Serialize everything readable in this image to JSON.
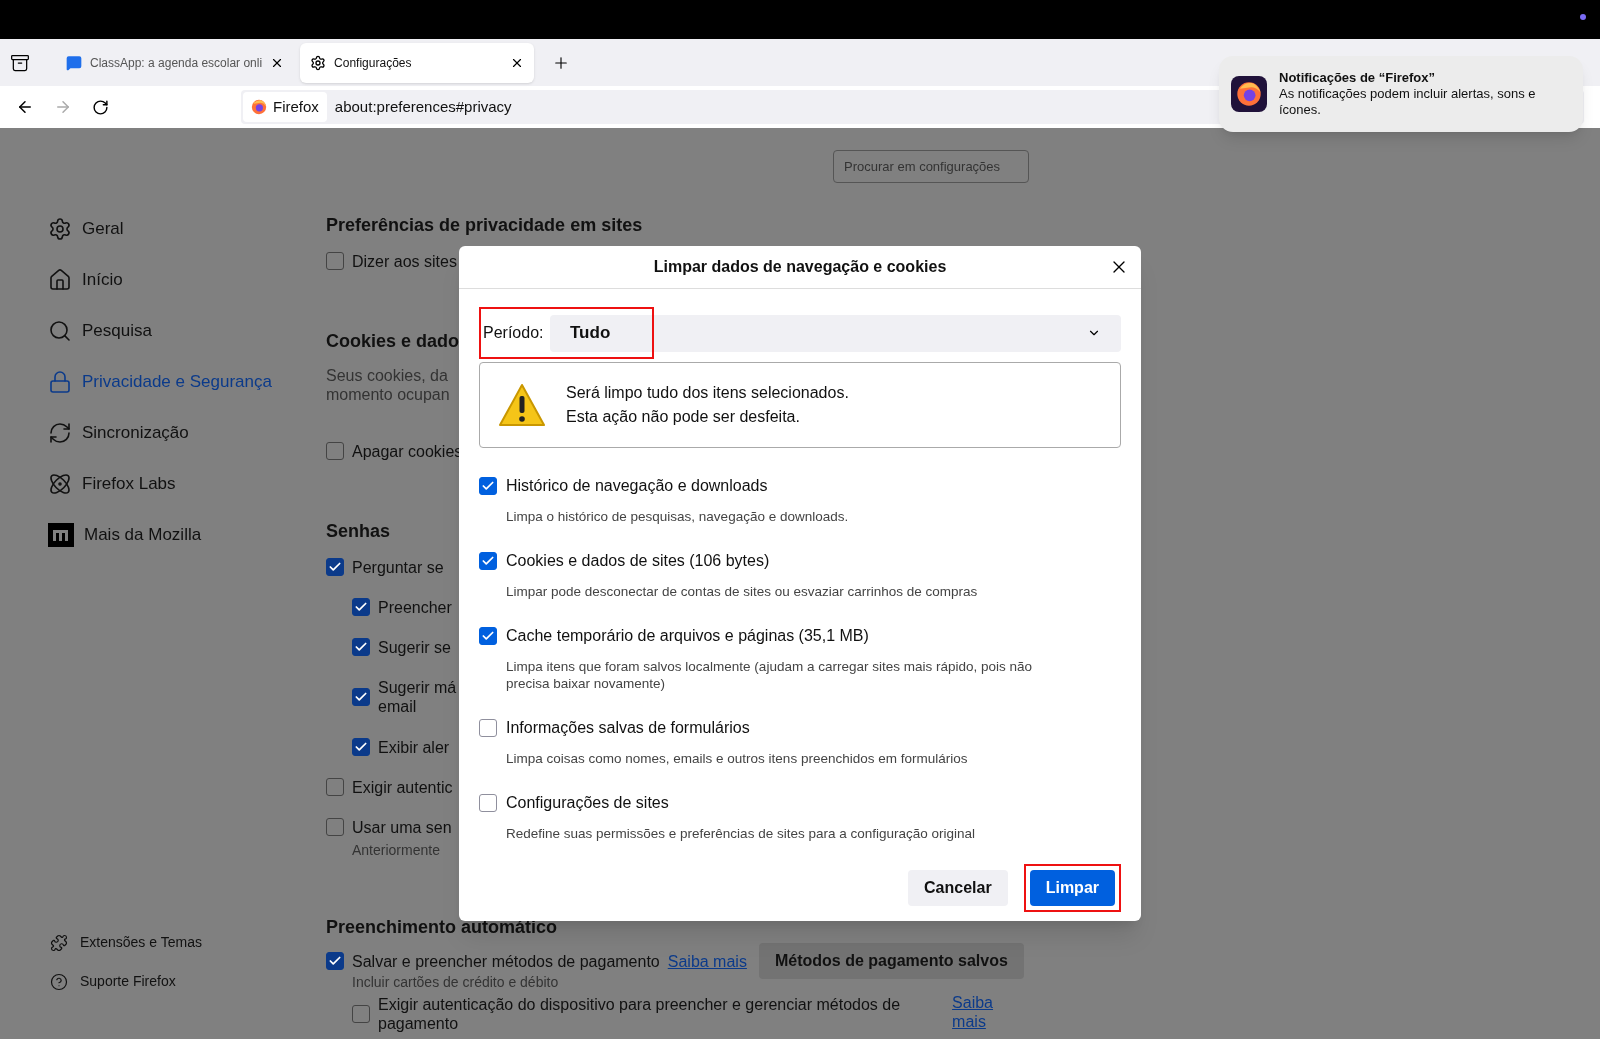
{
  "browser": {
    "tabs": [
      {
        "title": "ClassApp: a agenda escolar onli",
        "selected": false
      },
      {
        "title": "Configurações",
        "selected": true
      }
    ],
    "identity_label": "Firefox",
    "url": "about:preferences#privacy"
  },
  "notification": {
    "title": "Notificações de “Firefox”",
    "body": "As notificações podem incluir alertas, sons e ícones."
  },
  "search": {
    "placeholder": "Procurar em configurações"
  },
  "sidebar": {
    "items": [
      {
        "label": "Geral",
        "selected": false
      },
      {
        "label": "Início",
        "selected": false
      },
      {
        "label": "Pesquisa",
        "selected": false
      },
      {
        "label": "Privacidade e Segurança",
        "selected": true
      },
      {
        "label": "Sincronização",
        "selected": false
      },
      {
        "label": "Firefox Labs",
        "selected": false
      },
      {
        "label": "Mais da Mozilla",
        "selected": false
      }
    ],
    "footer": [
      {
        "label": "Extensões e Temas"
      },
      {
        "label": "Suporte Firefox"
      }
    ]
  },
  "content": [
    {
      "kind": "heading",
      "text": "Preferências de privacidade em sites"
    },
    {
      "kind": "checkbox",
      "lines": [
        "Dizer aos sites"
      ],
      "checked": false
    },
    {
      "kind": "heading",
      "text": "Cookies e dado"
    },
    {
      "kind": "text",
      "lines": [
        "Seus cookies, da",
        "momento ocupan"
      ]
    },
    {
      "kind": "checkbox",
      "lines": [
        "Apagar cookies"
      ],
      "checked": false
    },
    {
      "kind": "heading",
      "text": "Senhas"
    },
    {
      "kind": "checkbox",
      "lines": [
        "Perguntar se"
      ],
      "checked": true,
      "children": [
        {
          "kind": "checkbox",
          "lines": [
            "Preencher"
          ],
          "checked": true
        },
        {
          "kind": "checkbox",
          "lines": [
            "Sugerir se"
          ],
          "checked": true
        },
        {
          "kind": "checkbox",
          "lines": [
            "Sugerir má",
            "email"
          ],
          "checked": true
        },
        {
          "kind": "checkbox",
          "lines": [
            "Exibir aler"
          ],
          "checked": true
        }
      ]
    },
    {
      "kind": "checkbox",
      "lines": [
        "Exigir autentic"
      ],
      "checked": false
    },
    {
      "kind": "checkbox",
      "lines": [
        "Usar uma sen"
      ],
      "checked": false
    },
    {
      "kind": "note",
      "text": "Anteriormente"
    },
    {
      "kind": "heading",
      "text": "Preenchimento automático"
    },
    {
      "kind": "checkbox",
      "lines": [
        "Salvar e preencher métodos de pagamento"
      ],
      "checked": true,
      "link": "Saiba mais",
      "button": "Métodos de pagamento salvos",
      "children": [
        {
          "kind": "note",
          "text": "Incluir cartões de crédito e débito"
        },
        {
          "kind": "checkbox",
          "lines": [
            "Exigir autenticação do dispositivo para preencher e gerenciar métodos de",
            "pagamento"
          ],
          "checked": false,
          "link": "Saiba mais"
        }
      ]
    }
  ],
  "dialog": {
    "title": "Limpar dados de navegação e cookies",
    "period": {
      "label": "Período:",
      "value": "Tudo",
      "highlighted": true
    },
    "warning": [
      "Será limpo tudo dos itens selecionados.",
      "Esta ação não pode ser desfeita."
    ],
    "options": [
      {
        "label": "Histórico de navegação e downloads",
        "description": "Limpa o histórico de pesquisas, navegação e downloads.",
        "checked": true
      },
      {
        "label": "Cookies e dados de sites (106 bytes)",
        "description": "Limpar pode desconectar de contas de sites ou esvaziar carrinhos de compras",
        "checked": true
      },
      {
        "label": "Cache temporário de arquivos e páginas (35,1 MB)",
        "description": "Limpa itens que foram salvos localmente (ajudam a carregar sites mais rápido, pois não precisa baixar novamente)",
        "checked": true
      },
      {
        "label": "Informações salvas de formulários",
        "description": "Limpa coisas como nomes, emails e outros itens preenchidos em formulários",
        "checked": false
      },
      {
        "label": "Configurações de sites",
        "description": "Redefine suas permissões e preferências de sites para a configuração original",
        "checked": false
      }
    ],
    "buttons": [
      {
        "label": "Cancelar",
        "kind": "secondary",
        "highlighted": false
      },
      {
        "label": "Limpar",
        "kind": "primary",
        "highlighted": true
      }
    ]
  }
}
